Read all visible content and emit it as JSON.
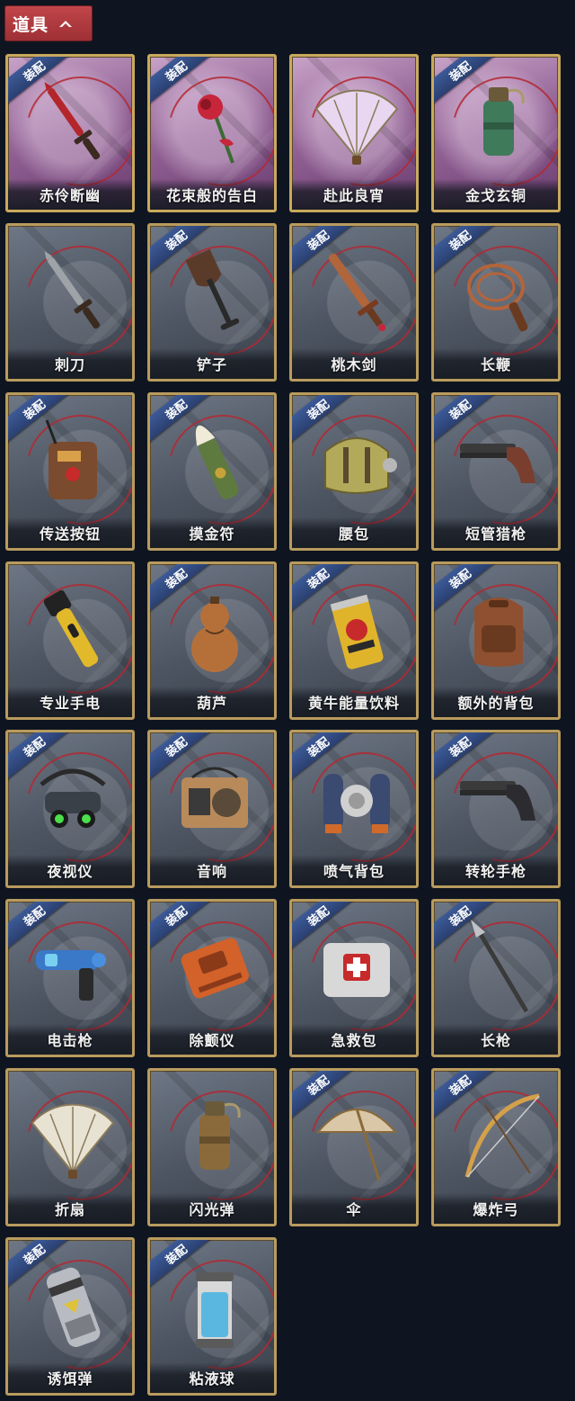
{
  "header": {
    "title": "道具",
    "toggle_icon": "chevron-up-icon"
  },
  "equip_label": "装配",
  "items": [
    {
      "name": "赤伶断幽",
      "equipped": true,
      "rare": true,
      "icon": "dagger-icon",
      "color": "#b3262c"
    },
    {
      "name": "花束般的告白",
      "equipped": true,
      "rare": true,
      "icon": "rose-icon",
      "color": "#c7263a"
    },
    {
      "name": "赴此良宵",
      "equipped": false,
      "rare": true,
      "icon": "fan-icon",
      "color": "#e9d6f0"
    },
    {
      "name": "金戈玄铜",
      "equipped": true,
      "rare": true,
      "icon": "bronze-grenade-icon",
      "color": "#3f7a5a"
    },
    {
      "name": "刺刀",
      "equipped": false,
      "rare": false,
      "icon": "bayonet-icon",
      "color": "#9ea3a8"
    },
    {
      "name": "铲子",
      "equipped": true,
      "rare": false,
      "icon": "shovel-icon",
      "color": "#5a3b2a"
    },
    {
      "name": "桃木剑",
      "equipped": true,
      "rare": false,
      "icon": "wooden-sword-icon",
      "color": "#b0653a"
    },
    {
      "name": "长鞭",
      "equipped": true,
      "rare": false,
      "icon": "whip-icon",
      "color": "#b4643a"
    },
    {
      "name": "传送按钮",
      "equipped": true,
      "rare": false,
      "icon": "remote-button-icon",
      "color": "#7a4b2e"
    },
    {
      "name": "摸金符",
      "equipped": true,
      "rare": false,
      "icon": "talisman-icon",
      "color": "#5f7a3e"
    },
    {
      "name": "腰包",
      "equipped": true,
      "rare": false,
      "icon": "waist-bag-icon",
      "color": "#b3a95a"
    },
    {
      "name": "短管猎枪",
      "equipped": true,
      "rare": false,
      "icon": "shotgun-icon",
      "color": "#7a3e2e"
    },
    {
      "name": "专业手电",
      "equipped": false,
      "rare": false,
      "icon": "flashlight-icon",
      "color": "#e2b92a"
    },
    {
      "name": "葫芦",
      "equipped": true,
      "rare": false,
      "icon": "gourd-icon",
      "color": "#b5703a"
    },
    {
      "name": "黄牛能量饮料",
      "equipped": true,
      "rare": false,
      "icon": "energy-drink-icon",
      "color": "#e0b42a"
    },
    {
      "name": "额外的背包",
      "equipped": true,
      "rare": false,
      "icon": "backpack-icon",
      "color": "#8e5030"
    },
    {
      "name": "夜视仪",
      "equipped": true,
      "rare": false,
      "icon": "night-vision-icon",
      "color": "#3a4048"
    },
    {
      "name": "音响",
      "equipped": true,
      "rare": false,
      "icon": "speaker-icon",
      "color": "#b88a5a"
    },
    {
      "name": "喷气背包",
      "equipped": true,
      "rare": false,
      "icon": "jetpack-icon",
      "color": "#3a4a70"
    },
    {
      "name": "转轮手枪",
      "equipped": true,
      "rare": false,
      "icon": "revolver-icon",
      "color": "#2c2c30"
    },
    {
      "name": "电击枪",
      "equipped": true,
      "rare": false,
      "icon": "shock-gun-icon",
      "color": "#3a78c8"
    },
    {
      "name": "除颤仪",
      "equipped": true,
      "rare": false,
      "icon": "defibrillator-icon",
      "color": "#d2612a"
    },
    {
      "name": "急救包",
      "equipped": true,
      "rare": false,
      "icon": "first-aid-kit-icon",
      "color": "#d8d8d8"
    },
    {
      "name": "长枪",
      "equipped": true,
      "rare": false,
      "icon": "spear-icon",
      "color": "#3a3a3a"
    },
    {
      "name": "折扇",
      "equipped": false,
      "rare": false,
      "icon": "folding-fan-icon",
      "color": "#e8e2d2"
    },
    {
      "name": "闪光弹",
      "equipped": false,
      "rare": false,
      "icon": "flash-grenade-icon",
      "color": "#8a6a3a"
    },
    {
      "name": "伞",
      "equipped": true,
      "rare": false,
      "icon": "umbrella-icon",
      "color": "#d9c7a8"
    },
    {
      "name": "爆炸弓",
      "equipped": true,
      "rare": false,
      "icon": "bow-icon",
      "color": "#d4a04a"
    },
    {
      "name": "诱饵弹",
      "equipped": true,
      "rare": false,
      "icon": "decoy-grenade-icon",
      "color": "#b8bcc2"
    },
    {
      "name": "粘液球",
      "equipped": true,
      "rare": false,
      "icon": "slime-capsule-icon",
      "color": "#5ab8e0"
    }
  ]
}
